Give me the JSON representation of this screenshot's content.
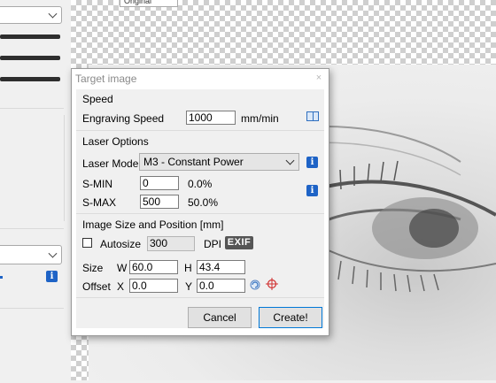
{
  "background": {
    "canvas_tab_label": "Original"
  },
  "dialog": {
    "title": "Target image",
    "close_glyph": "×",
    "speed": {
      "group_title": "Speed",
      "engraving_speed_label": "Engraving Speed",
      "engraving_speed_value": "1000",
      "unit": "mm/min",
      "help_icon": "book-icon"
    },
    "laser": {
      "group_title": "Laser Options",
      "mode_label": "Laser Mode",
      "mode_value": "M3 - Constant Power",
      "smin_label": "S-MIN",
      "smin_value": "0",
      "smin_percent": "0.0%",
      "smax_label": "S-MAX",
      "smax_value": "500",
      "smax_percent": "50.0%"
    },
    "image": {
      "group_title": "Image Size and Position [mm]",
      "autosize_label": "Autosize",
      "autosize_checked": false,
      "dpi_value": "300",
      "dpi_label": "DPI",
      "exif_label": "EXIF",
      "size_label": "Size",
      "w_label": "W",
      "w_value": "60.0",
      "h_label": "H",
      "h_value": "43.4",
      "offset_label": "Offset",
      "x_label": "X",
      "x_value": "0.0",
      "y_label": "Y",
      "y_value": "0.0"
    },
    "buttons": {
      "cancel": "Cancel",
      "create": "Create!"
    }
  },
  "colors": {
    "info_blue": "#1e63c6",
    "primary_border": "#0078d7",
    "target_red": "#d03030"
  }
}
